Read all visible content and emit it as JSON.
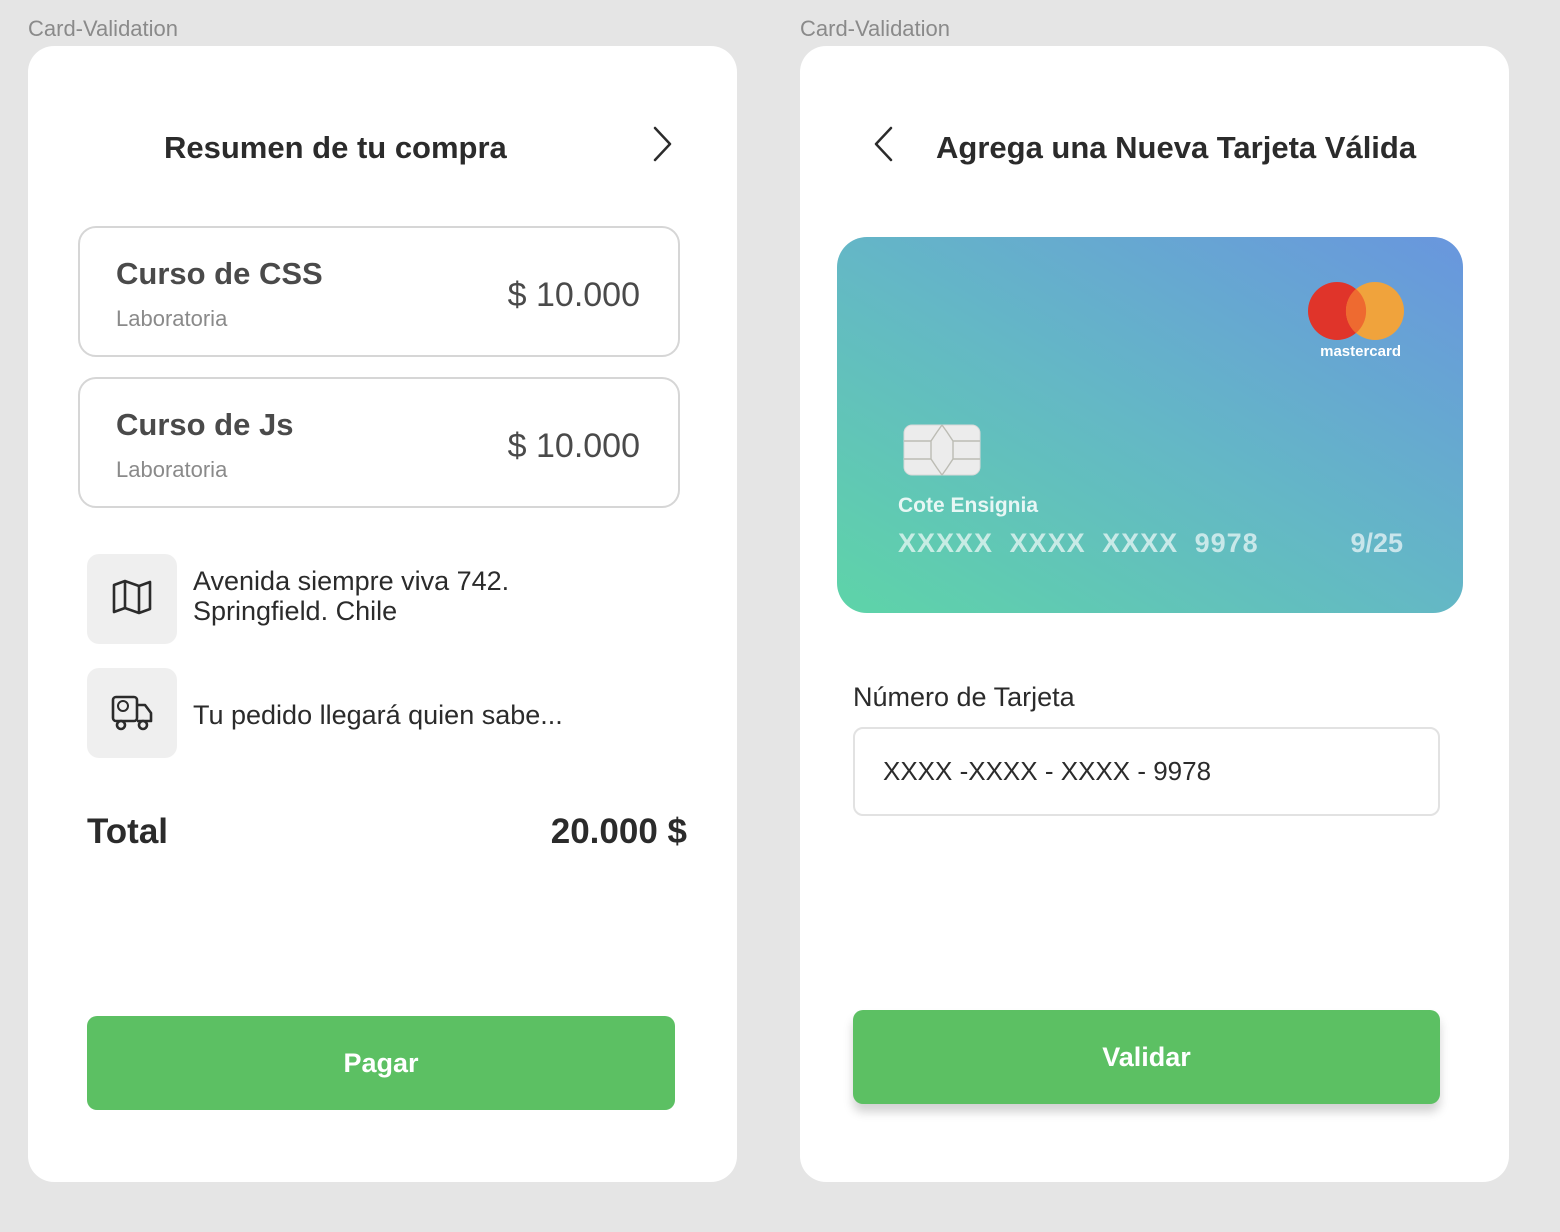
{
  "frames": {
    "left_label": "Card-Validation",
    "right_label": "Card-Validation"
  },
  "summary": {
    "title": "Resumen de  tu compra",
    "courses": [
      {
        "name": "Curso de CSS",
        "provider": "Laboratoria",
        "price": "$ 10.000"
      },
      {
        "name": "Curso de Js",
        "provider": "Laboratoria",
        "price": "$ 10.000"
      }
    ],
    "address_line1": "Avenida siempre viva 742.",
    "address_line2": "Springfield. Chile",
    "delivery": "Tu pedido llegará quien sabe...",
    "total_label": "Total",
    "total_value": "20.000 $",
    "pay_button": "Pagar"
  },
  "add_card": {
    "title": "Agrega una Nueva Tarjeta Válida",
    "card": {
      "brand": "mastercard",
      "holder": "Cote Ensignia",
      "number": "XXXXX  XXXX   XXXX 9978",
      "expiry": "9/25"
    },
    "field_label": "Número de Tarjeta",
    "field_value": "XXXX -XXXX - XXXX - 9978",
    "validate_button": "Validar"
  },
  "colors": {
    "background": "#e5e5e5",
    "green_button": "#5cc063",
    "card_gradient_start": "#5ed4a8",
    "card_gradient_end": "#6996de",
    "mastercard_red": "#e0342a",
    "mastercard_orange": "#f0a33c"
  },
  "icons": [
    "chevron-right-icon",
    "chevron-left-icon",
    "map-icon",
    "truck-icon",
    "mastercard-logo",
    "card-chip-icon"
  ]
}
